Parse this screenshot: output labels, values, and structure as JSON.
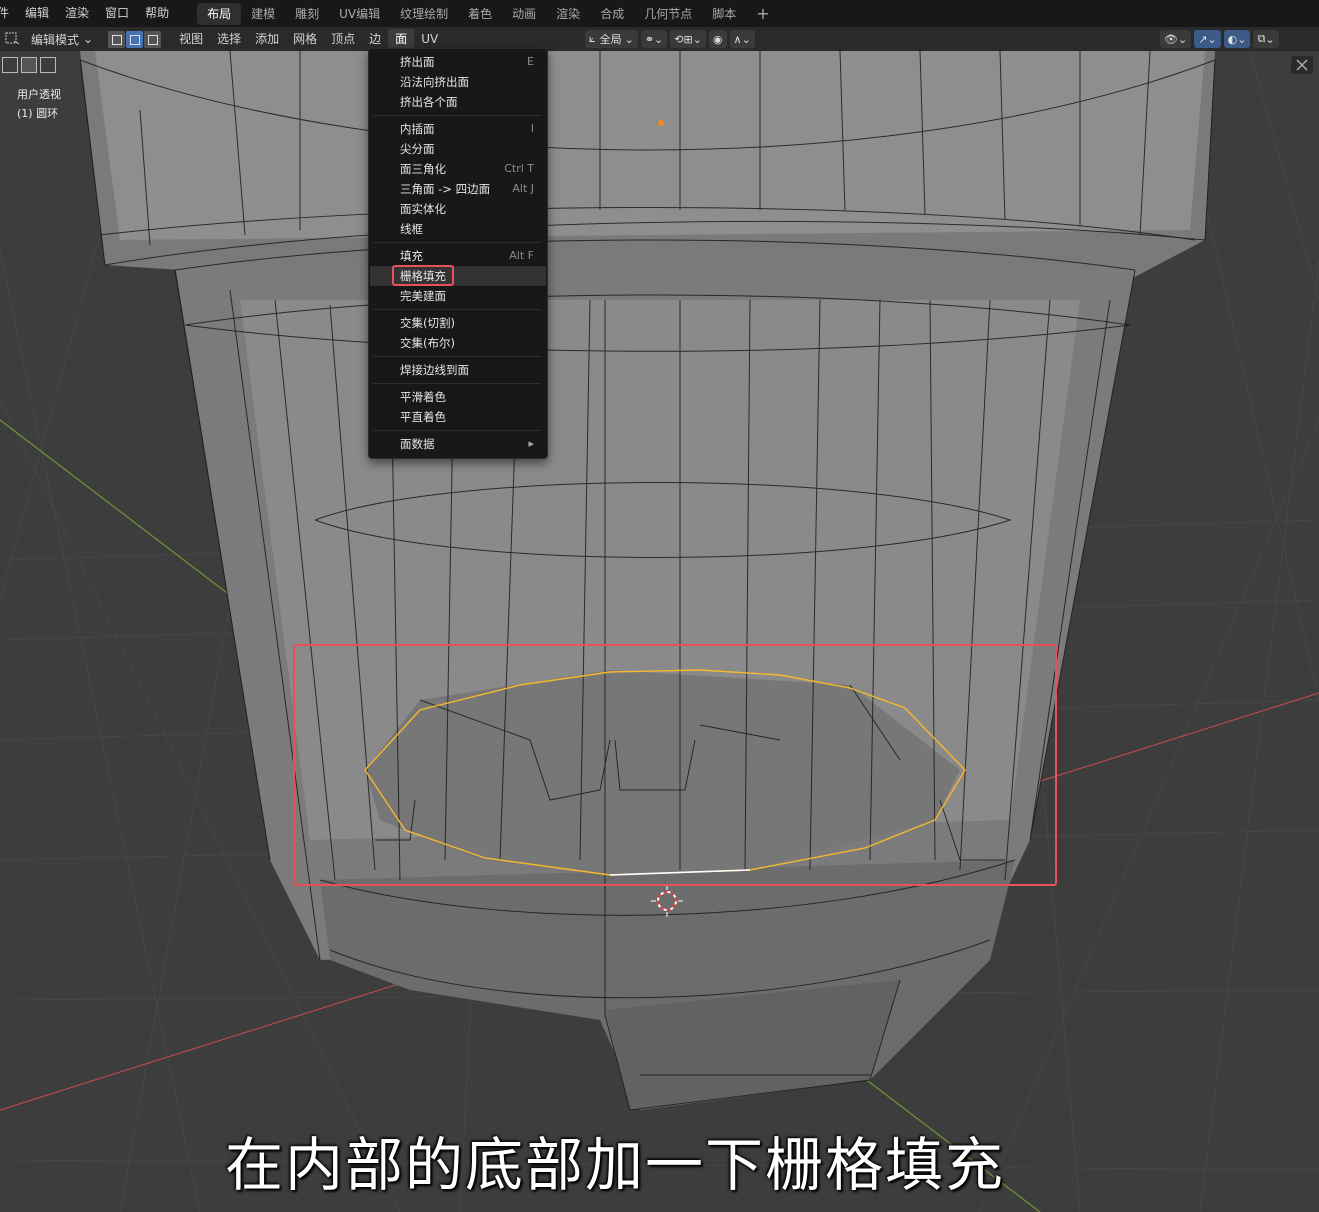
{
  "top_menu": [
    "件",
    "编辑",
    "渲染",
    "窗口",
    "帮助"
  ],
  "workspaces": [
    {
      "label": "布局",
      "active": true
    },
    {
      "label": "建模",
      "active": false
    },
    {
      "label": "雕刻",
      "active": false
    },
    {
      "label": "UV编辑",
      "active": false
    },
    {
      "label": "纹理绘制",
      "active": false
    },
    {
      "label": "着色",
      "active": false
    },
    {
      "label": "动画",
      "active": false
    },
    {
      "label": "渲染",
      "active": false
    },
    {
      "label": "合成",
      "active": false
    },
    {
      "label": "几何节点",
      "active": false
    },
    {
      "label": "脚本",
      "active": false
    }
  ],
  "workspace_add": "+",
  "header": {
    "mode": "编辑模式",
    "menus": [
      "视图",
      "选择",
      "添加",
      "网格",
      "顶点",
      "边",
      "面",
      "UV"
    ],
    "active_menu": "面",
    "transform_orientation": "全局"
  },
  "viewport": {
    "view_name": "用户透视",
    "object_name": "(1) 圆环"
  },
  "face_menu": {
    "groups": [
      [
        {
          "label": "挤出面",
          "shortcut": "E"
        },
        {
          "label": "沿法向挤出面",
          "shortcut": ""
        },
        {
          "label": "挤出各个面",
          "shortcut": ""
        }
      ],
      [
        {
          "label": "内插面",
          "shortcut": "I"
        },
        {
          "label": "尖分面",
          "shortcut": ""
        },
        {
          "label": "面三角化",
          "shortcut": "Ctrl T"
        },
        {
          "label": "三角面 -> 四边面",
          "shortcut": "Alt J"
        },
        {
          "label": "面实体化",
          "shortcut": ""
        },
        {
          "label": "线框",
          "shortcut": ""
        }
      ],
      [
        {
          "label": "填充",
          "shortcut": "Alt F"
        },
        {
          "label": "栅格填充",
          "shortcut": "",
          "highlighted": true
        },
        {
          "label": "完美建面",
          "shortcut": ""
        }
      ],
      [
        {
          "label": "交集(切割)",
          "shortcut": ""
        },
        {
          "label": "交集(布尔)",
          "shortcut": ""
        }
      ],
      [
        {
          "label": "焊接边线到面",
          "shortcut": ""
        }
      ],
      [
        {
          "label": "平滑着色",
          "shortcut": ""
        },
        {
          "label": "平直着色",
          "shortcut": ""
        }
      ],
      [
        {
          "label": "面数据",
          "shortcut": "",
          "submenu": true
        }
      ]
    ]
  },
  "caption": "在内部的底部加一下栅格填充",
  "colors": {
    "highlight": "#e8505b",
    "selected_edge": "#f5b82e",
    "active_edge": "#ffffff",
    "x_axis": "#c24a52",
    "y_axis": "#7aa33a"
  }
}
